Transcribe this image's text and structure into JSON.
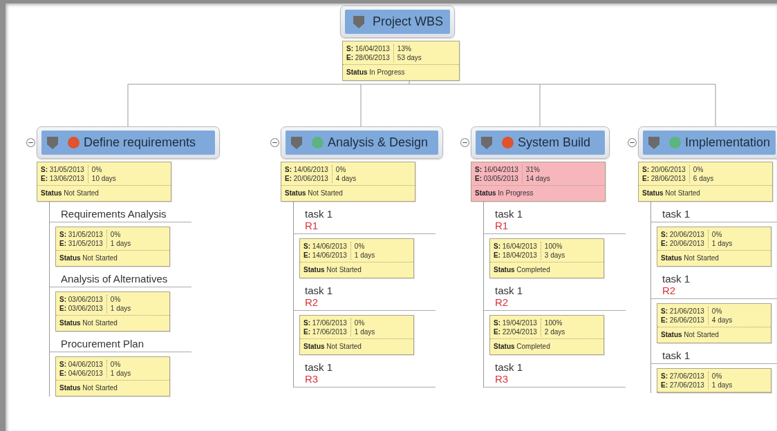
{
  "root": {
    "title": "Project WBS",
    "card": {
      "start": "**S:** 16/04/2013",
      "end": "**E:** 28/06/2013",
      "percent": "13%",
      "duration": "53 days",
      "status": "**Status** In Progress",
      "highlight": false
    }
  },
  "branches": [
    {
      "title": "Define requirements",
      "color": "#e0532e",
      "expanded": true,
      "card": {
        "start": "**S:** 31/05/2013",
        "end": "**E:** 13/06/2013",
        "percent": "0%",
        "duration": "10 days",
        "status": "**Status** Not Started",
        "highlight": false
      },
      "children": [
        {
          "title": "Requirements Analysis",
          "card": {
            "start": "**S:** 31/05/2013",
            "end": "**E:** 31/05/2013",
            "percent": "0%",
            "duration": "1 days",
            "status": "**Status** Not Started",
            "highlight": false
          }
        },
        {
          "title": "Analysis of Alternatives",
          "card": {
            "start": "**S:** 03/06/2013",
            "end": "**E:** 03/06/2013",
            "percent": "0%",
            "duration": "1 days",
            "status": "**Status** Not Started",
            "highlight": false
          }
        },
        {
          "title": "Procurement Plan",
          "card": {
            "start": "**S:** 04/06/2013",
            "end": "**E:** 04/06/2013",
            "percent": "0%",
            "duration": "1 days",
            "status": "**Status** Not Started",
            "highlight": false
          }
        }
      ]
    },
    {
      "title": "Analysis & Design",
      "color": "#5cb581",
      "expanded": true,
      "card": {
        "start": "**S:** 14/06/2013",
        "end": "**E:** 20/06/2013",
        "percent": "0%",
        "duration": "4 days",
        "status": "**Status** Not Started",
        "highlight": false
      },
      "children": [
        {
          "title": "task 1",
          "resource": "R1",
          "card": {
            "start": "**S:** 14/06/2013",
            "end": "**E:** 14/06/2013",
            "percent": "0%",
            "duration": "1 days",
            "status": "**Status** Not Started",
            "highlight": false
          }
        },
        {
          "title": "task 1",
          "resource": "R2",
          "card": {
            "start": "**S:** 17/06/2013",
            "end": "**E:** 17/06/2013",
            "percent": "0%",
            "duration": "1 days",
            "status": "**Status** Not Started",
            "highlight": false
          }
        },
        {
          "title": "task 1",
          "resource": "R3"
        }
      ]
    },
    {
      "title": "System Build",
      "color": "#e0532e",
      "expanded": true,
      "card": {
        "start": "**S:** 16/04/2013",
        "end": "**E:** 03/05/2013",
        "percent": "31%",
        "duration": "14 days",
        "status": "**Status** In Progress",
        "highlight": true
      },
      "children": [
        {
          "title": "task 1",
          "resource": "R1",
          "card": {
            "start": "**S:** 16/04/2013",
            "end": "**E:** 18/04/2013",
            "percent": "100%",
            "duration": "3 days",
            "status": "**Status** Completed",
            "highlight": false
          }
        },
        {
          "title": "task 1",
          "resource": "R2",
          "card": {
            "start": "**S:** 19/04/2013",
            "end": "**E:** 22/04/2013",
            "percent": "100%",
            "duration": "2 days",
            "status": "**Status** Completed",
            "highlight": false
          }
        },
        {
          "title": "task 1",
          "resource": "R3"
        }
      ]
    },
    {
      "title": "Implementation",
      "color": "#5cb581",
      "expanded": true,
      "card": {
        "start": "**S:** 20/06/2013",
        "end": "**E:** 28/06/2013",
        "percent": "0%",
        "duration": "6 days",
        "status": "**Status** Not Started",
        "highlight": false
      },
      "children": [
        {
          "title": "task 1",
          "card": {
            "start": "**S:** 20/06/2013",
            "end": "**E:** 20/06/2013",
            "percent": "0%",
            "duration": "1 days",
            "status": "**Status** Not Started",
            "highlight": false
          }
        },
        {
          "title": "task 1",
          "resource": "R2",
          "card": {
            "start": "**S:** 21/06/2013",
            "end": "**E:** 26/06/2013",
            "percent": "0%",
            "duration": "4 days",
            "status": "**Status** Not Started",
            "highlight": false
          }
        },
        {
          "title": "task 1",
          "card": {
            "start": "**S:** 27/06/2013",
            "end": "**E:** 27/06/2013",
            "percent": "0%",
            "duration": "1 days",
            "highlight": false
          }
        }
      ]
    }
  ]
}
